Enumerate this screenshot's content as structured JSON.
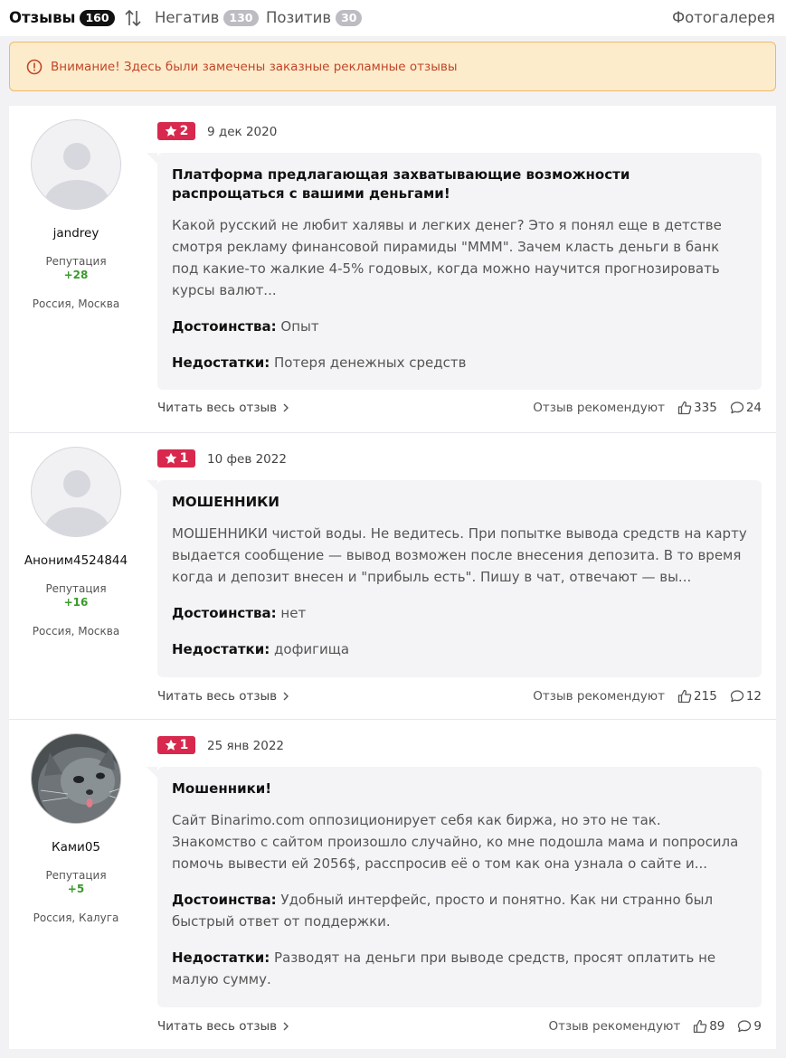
{
  "tabs": {
    "reviews": {
      "label": "Отзывы",
      "count": "160"
    },
    "sort_icon": "sort-arrows-icon",
    "negative": {
      "label": "Негатив",
      "count": "130"
    },
    "positive": {
      "label": "Позитив",
      "count": "30"
    },
    "gallery": "Фотогалерея"
  },
  "warning": {
    "icon": "exclamation-circle-icon",
    "text": "Внимание! Здесь были замечены заказные рекламные отзывы"
  },
  "labels": {
    "reputation": "Репутация",
    "pros": "Достоинства:",
    "cons": "Недостатки:",
    "read_more": "Читать весь отзыв",
    "recommend": "Отзыв рекомендуют"
  },
  "colors": {
    "rating_badge": "#d8284e",
    "reputation": "#3a9a2b",
    "warning_bg": "#fdeccb",
    "warning_text": "#c0462a"
  },
  "reviews": [
    {
      "author": "jandrey",
      "avatar": "default-user-avatar",
      "reputation": "+28",
      "location": "Россия, Москва",
      "rating": "2",
      "date": "9 дек 2020",
      "title": "Платформа предлагающая захватывающие возможности распрощаться с вашими деньгами!",
      "text": "Какой русский не любит халявы и легких денег? Это я понял еще в детстве смотря рекламу финансовой пирамиды \"МММ\". Зачем класть деньги в банк под какие-то жалкие 4-5% годовых, когда можно научится прогнозировать курсы валют...",
      "pros": "Опыт",
      "cons": "Потеря денежных средств",
      "likes": "335",
      "comments": "24"
    },
    {
      "author": "Аноним4524844",
      "avatar": "default-user-avatar",
      "reputation": "+16",
      "location": "Россия, Москва",
      "rating": "1",
      "date": "10 фев 2022",
      "title": "МОШЕННИКИ",
      "text": "МОШЕННИКИ чистой воды. Не ведитесь. При попытке вывода средств на карту выдается сообщение — вывод возможен после внесения депозита. В то время когда и депозит внесен и \"прибыль есть\". Пишу в чат, отвечают — вы...",
      "pros": "нет",
      "cons": "дофигища",
      "likes": "215",
      "comments": "12"
    },
    {
      "author": "Ками05",
      "avatar": "cat-photo-avatar",
      "reputation": "+5",
      "location": "Россия, Калуга",
      "rating": "1",
      "date": "25 янв 2022",
      "title": "Мошенники!",
      "text": "Сайт Binarimo.com оппозиционирует себя как биржа, но это не так. Знакомство с сайтом произошло случайно, ко мне подошла мама и попросила помочь вывести ей 2056$, расспросив её о том как она узнала о сайте и...",
      "pros": "Удобный интерфейс, просто и понятно. Как ни странно был быстрый ответ от поддержки.",
      "cons": "Разводят на деньги при выводе средств, просят оплатить не малую сумму.",
      "likes": "89",
      "comments": "9"
    }
  ]
}
